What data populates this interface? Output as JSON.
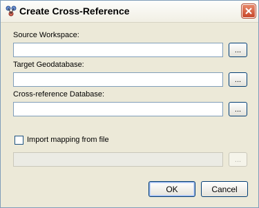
{
  "window": {
    "title": "Create Cross-Reference"
  },
  "fields": {
    "source_workspace": {
      "label": "Source Workspace:",
      "value": "",
      "browse_label": "..."
    },
    "target_geodatabase": {
      "label": "Target Geodatabase:",
      "value": "",
      "browse_label": "..."
    },
    "cross_reference_database": {
      "label": "Cross-reference Database:",
      "value": "",
      "browse_label": "..."
    }
  },
  "import_mapping": {
    "label": "Import mapping from file",
    "checked": false,
    "value": "",
    "browse_label": "..."
  },
  "buttons": {
    "ok": "OK",
    "cancel": "Cancel"
  }
}
